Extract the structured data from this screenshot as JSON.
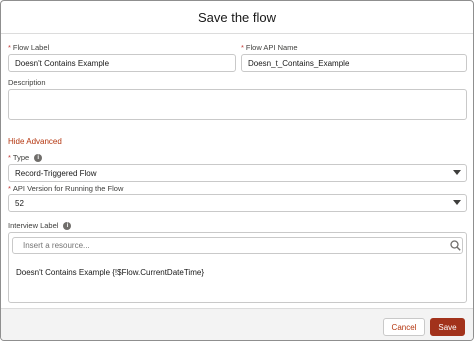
{
  "modal": {
    "title": "Save the flow"
  },
  "form": {
    "flow_label": {
      "label": "Flow Label",
      "required_mark": "*",
      "value": "Doesn't Contains Example"
    },
    "api_name": {
      "label": "Flow API Name",
      "required_mark": "*",
      "value": "Doesn_t_Contains_Example"
    },
    "description": {
      "label": "Description",
      "value": ""
    },
    "hide_advanced": "Hide Advanced",
    "type": {
      "label": "Type",
      "required_mark": "*",
      "info_icon": "info-icon",
      "value": "Record-Triggered Flow"
    },
    "api_version": {
      "label": "API Version for Running the Flow",
      "required_mark": "*",
      "value": "52"
    },
    "interview_label": {
      "label": "Interview Label",
      "info_icon": "info-icon",
      "search_placeholder": "Insert a resource...",
      "search_icon": "search-icon",
      "value": "Doesn't Contains Example {!$Flow.CurrentDateTime}"
    }
  },
  "footer": {
    "cancel_label": "Cancel",
    "save_label": "Save"
  },
  "colors": {
    "accent": "#b4350e",
    "save_bg": "#a2321b",
    "required": "#c23934",
    "footer_bg": "#f3f3f3"
  }
}
